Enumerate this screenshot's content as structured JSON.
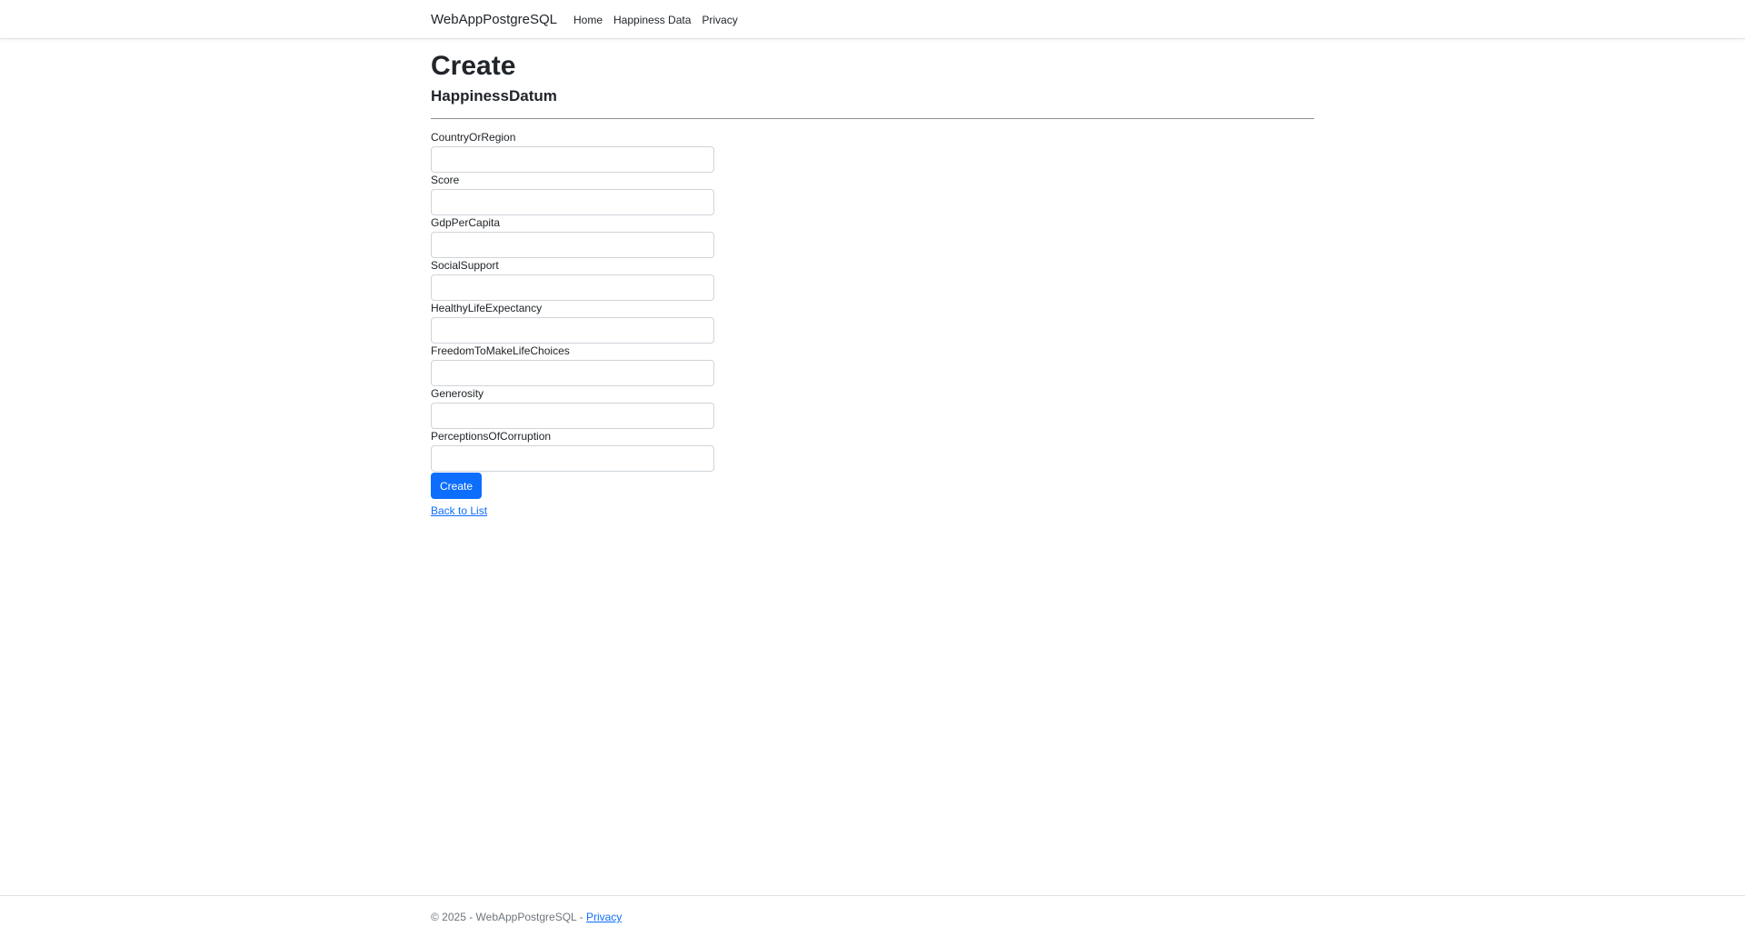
{
  "navbar": {
    "brand": "WebAppPostgreSQL",
    "links": [
      "Home",
      "Happiness Data",
      "Privacy"
    ]
  },
  "page": {
    "title": "Create",
    "subtitle": "HappinessDatum"
  },
  "form": {
    "fields": [
      {
        "label": "CountryOrRegion",
        "value": ""
      },
      {
        "label": "Score",
        "value": ""
      },
      {
        "label": "GdpPerCapita",
        "value": ""
      },
      {
        "label": "SocialSupport",
        "value": ""
      },
      {
        "label": "HealthyLifeExpectancy",
        "value": ""
      },
      {
        "label": "FreedomToMakeLifeChoices",
        "value": ""
      },
      {
        "label": "Generosity",
        "value": ""
      },
      {
        "label": "PerceptionsOfCorruption",
        "value": ""
      }
    ],
    "submit_label": "Create",
    "back_label": "Back to List"
  },
  "footer": {
    "text": "© 2025 - WebAppPostgreSQL - ",
    "link": "Privacy"
  },
  "colors": {
    "accent": "#0d6efd",
    "text": "#212529",
    "muted": "#6c757d",
    "border": "#ced4da"
  }
}
